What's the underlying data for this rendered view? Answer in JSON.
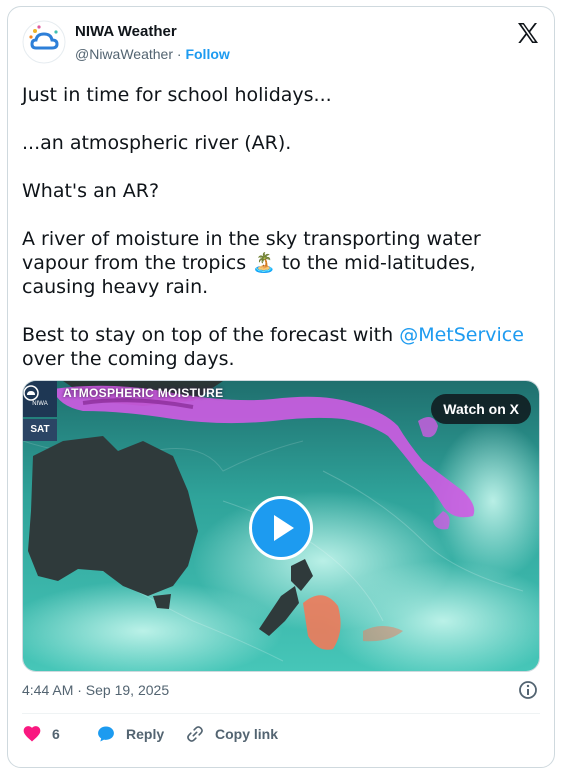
{
  "author": {
    "name": "NIWA Weather",
    "handle": "@NiwaWeather",
    "separator": "·",
    "follow_label": "Follow",
    "avatar_icon": "niwa-cloud-logo"
  },
  "tweet": {
    "paragraphs": [
      "Just in time for school holidays...",
      "...an atmospheric river (AR).",
      "What's an AR?"
    ],
    "p4_before_emoji": "A river of moisture in the sky transporting water vapour from the tropics ",
    "p4_emoji": "🏝️",
    "p4_after_emoji": " to the mid-latitudes, causing heavy rain.",
    "p5_before": "Best to stay on top of the forecast with ",
    "p5_mention": "@MetService",
    "p5_after": " over the coming days."
  },
  "media": {
    "logo_text": "NIWA",
    "badge": "SAT",
    "title": "ATMOSPHERIC MOISTURE",
    "watch_label": "Watch on X",
    "play_icon": "play-icon"
  },
  "meta": {
    "timestamp": "4:44 AM · Sep 19, 2025"
  },
  "actions": {
    "like_count": "6",
    "reply_label": "Reply",
    "copy_label": "Copy link"
  },
  "colors": {
    "accent": "#1d9bf0",
    "like": "#f91880",
    "moisture_purple": "#d45ce8",
    "ocean_teal": "#3fbfb3"
  }
}
